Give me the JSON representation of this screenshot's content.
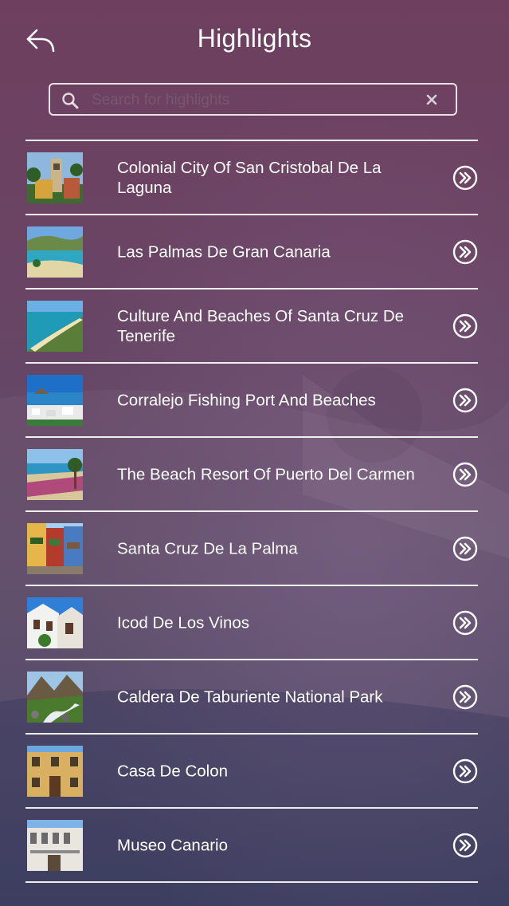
{
  "header": {
    "title": "Highlights",
    "back_icon": "back-reply-arrow-icon"
  },
  "search": {
    "placeholder": "Search for highlights",
    "value": "",
    "icon": "search-icon",
    "clear_icon": "clear-x-icon"
  },
  "items": [
    {
      "label": "Colonial City Of San Cristobal De La Laguna",
      "thumb": "church-tower"
    },
    {
      "label": "Las Palmas De Gran Canaria",
      "thumb": "beach-bay"
    },
    {
      "label": "Culture And Beaches Of Santa Cruz De Tenerife",
      "thumb": "beach-aerial"
    },
    {
      "label": "Corralejo Fishing Port And Beaches",
      "thumb": "harbor-town"
    },
    {
      "label": "The Beach Resort Of Puerto Del Carmen",
      "thumb": "resort-beach"
    },
    {
      "label": "Santa Cruz De La Palma",
      "thumb": "balconies"
    },
    {
      "label": "Icod De Los Vinos",
      "thumb": "white-houses"
    },
    {
      "label": "Caldera De Taburiente National Park",
      "thumb": "mountain-river"
    },
    {
      "label": "Casa De Colon",
      "thumb": "colonial-house"
    },
    {
      "label": "Museo Canario",
      "thumb": "museum-building"
    }
  ],
  "colors": {
    "bg_top": "#6f3f5f",
    "bg_bottom": "#3f3f5f",
    "text": "#ffffff"
  }
}
